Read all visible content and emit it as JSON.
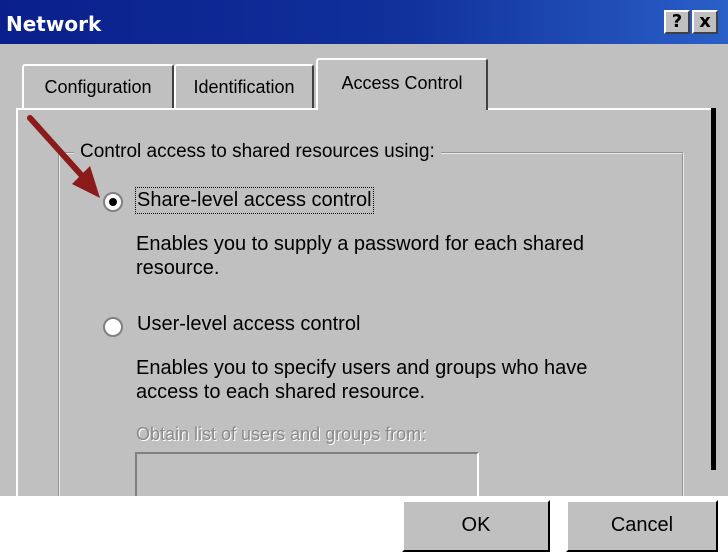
{
  "window": {
    "title": "Network",
    "help_button": "?",
    "close_button": "x"
  },
  "tabs": [
    {
      "label": "Configuration"
    },
    {
      "label": "Identification"
    },
    {
      "label": "Access Control",
      "active": true
    }
  ],
  "group": {
    "legend": "Control access to shared resources using:"
  },
  "options": {
    "share_level": {
      "label": "Share-level access control",
      "selected": true,
      "description_line1": "Enables you to supply a password for each shared",
      "description_line2": "resource."
    },
    "user_level": {
      "label": "User-level access control",
      "selected": false,
      "description_line1": "Enables you to specify users and groups who have",
      "description_line2": "access to each shared resource."
    }
  },
  "obtain_list": {
    "label": "Obtain list of users and groups from:",
    "value": ""
  },
  "buttons": {
    "ok": "OK",
    "cancel": "Cancel"
  },
  "colors": {
    "title_bar": "#0a1f8c",
    "dialog_face": "#c0c0c0",
    "annotation_arrow": "#8b1a1a"
  },
  "icons": {
    "annotation": "red-arrow-icon"
  }
}
